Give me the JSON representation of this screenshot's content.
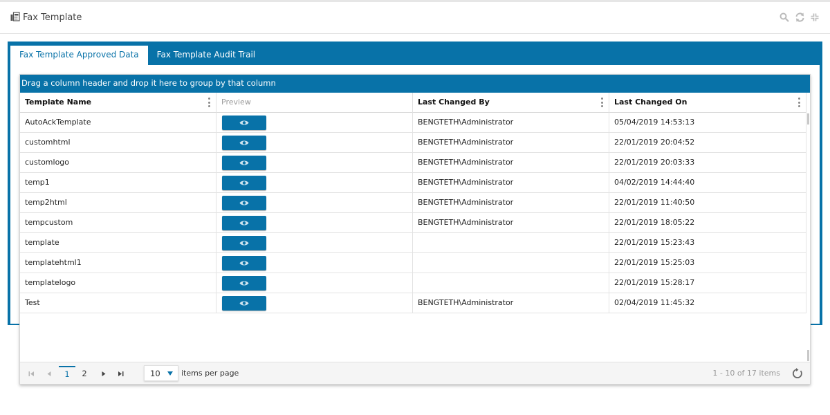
{
  "header": {
    "title": "Fax Template",
    "icon": "fax-icon",
    "tools": [
      "search-icon",
      "refresh-icon",
      "compress-icon"
    ]
  },
  "tabs": [
    {
      "label": "Fax Template Approved Data",
      "active": true
    },
    {
      "label": "Fax Template Audit Trail",
      "active": false
    }
  ],
  "grid": {
    "group_hint": "Drag a column header and drop it here to group by that column",
    "columns": [
      "Template Name",
      "Preview",
      "Last Changed By",
      "Last Changed On"
    ],
    "rows": [
      {
        "name": "AutoAckTemplate",
        "by": "BENGTETH\\Administrator",
        "on": "05/04/2019 14:53:13"
      },
      {
        "name": "customhtml",
        "by": "BENGTETH\\Administrator",
        "on": "22/01/2019 20:04:52"
      },
      {
        "name": "customlogo",
        "by": "BENGTETH\\Administrator",
        "on": "22/01/2019 20:03:33"
      },
      {
        "name": "temp1",
        "by": "BENGTETH\\Administrator",
        "on": "04/02/2019 14:44:40"
      },
      {
        "name": "temp2html",
        "by": "BENGTETH\\Administrator",
        "on": "22/01/2019 11:40:50"
      },
      {
        "name": "tempcustom",
        "by": "BENGTETH\\Administrator",
        "on": "22/01/2019 18:05:22"
      },
      {
        "name": "template",
        "by": "",
        "on": "22/01/2019 15:23:43"
      },
      {
        "name": "templatehtml1",
        "by": "",
        "on": "22/01/2019 15:25:03"
      },
      {
        "name": "templatelogo",
        "by": "",
        "on": "22/01/2019 15:28:17"
      },
      {
        "name": "Test",
        "by": "BENGTETH\\Administrator",
        "on": "02/04/2019 11:45:32"
      }
    ]
  },
  "pager": {
    "pages": [
      "1",
      "2"
    ],
    "current_page": "1",
    "page_size": "10",
    "items_per_page_label": "items per page",
    "info": "1 - 10 of 17 items"
  },
  "colors": {
    "accent": "#0872a8",
    "header_text": "#444444",
    "muted": "#999999"
  }
}
